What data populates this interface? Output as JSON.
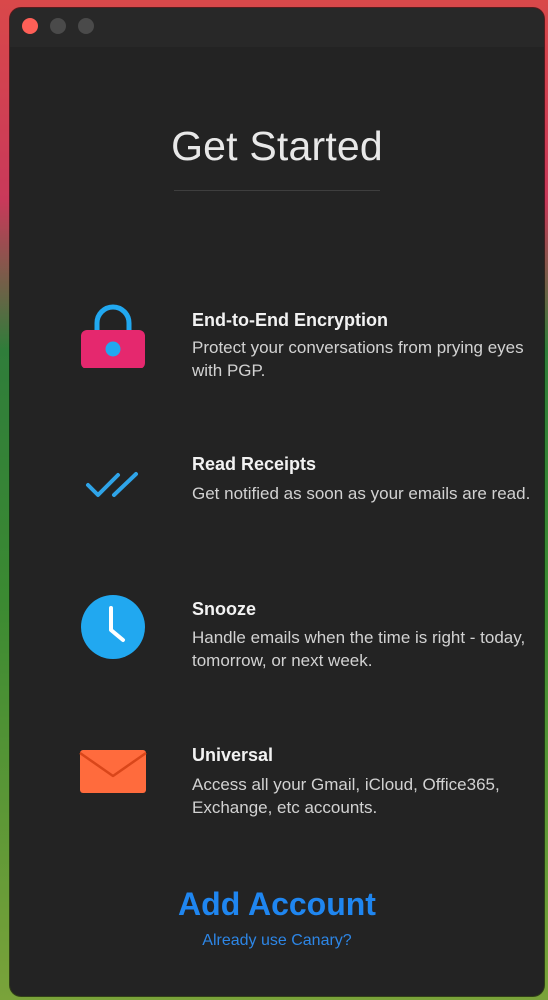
{
  "window": {
    "title": "Get Started"
  },
  "colors": {
    "accent": "#1f86f0",
    "lock_body": "#e5286e",
    "lock_shackle": "#21a8f0",
    "receipt_check": "#2fa4e8",
    "clock_face": "#21a8f0",
    "envelope": "#ff6b3d"
  },
  "features": [
    {
      "icon": "lock-icon",
      "title": "End-to-End Encryption",
      "desc": "Protect your conversations from prying eyes with PGP."
    },
    {
      "icon": "double-check-icon",
      "title": "Read Receipts",
      "desc": "Get notified as soon as your emails are read."
    },
    {
      "icon": "clock-icon",
      "title": "Snooze",
      "desc": "Handle emails when the time is right - today, tomorrow, or next week."
    },
    {
      "icon": "envelope-icon",
      "title": "Universal",
      "desc": "Access all your Gmail, iCloud, Office365, Exchange, etc accounts."
    }
  ],
  "actions": {
    "add_account": "Add Account",
    "already_use": "Already use Canary?"
  }
}
